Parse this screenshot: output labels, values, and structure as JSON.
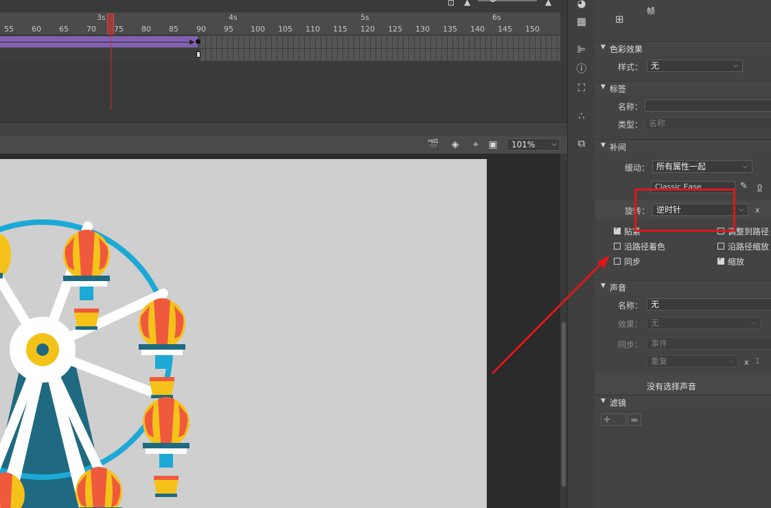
{
  "timeline": {
    "seconds": [
      "3s",
      "4s",
      "5s",
      "6s"
    ],
    "frame_ticks": [
      "55",
      "60",
      "65",
      "70",
      "75",
      "80",
      "85",
      "90",
      "95",
      "100",
      "105",
      "110",
      "115",
      "120",
      "125",
      "130",
      "135",
      "140",
      "145",
      "150"
    ],
    "current_frame": 73
  },
  "stage": {
    "zoom": "101%"
  },
  "dock_icons": [
    "palette-icon",
    "swatches-icon",
    "align-icon",
    "info-icon",
    "transform-icon",
    "motion-presets-icon",
    "library-icon"
  ],
  "properties": {
    "frame_label": "帧",
    "color_effect": {
      "title": "色彩效果",
      "style_label": "样式：",
      "style_value": "无"
    },
    "label": {
      "title": "标签",
      "name_label": "名称：",
      "name_value": "",
      "type_label": "类型：",
      "type_value": "名称"
    },
    "tween": {
      "title": "补间",
      "ease_label": "缓动：",
      "ease_value": "所有属性一起",
      "ease_preset": "Classic Ease",
      "ease_amount": "0",
      "rotate_label": "旋转：",
      "rotate_value": "逆时针",
      "rotate_times_sep": "x",
      "checkboxes": [
        {
          "label": "贴紧",
          "checked": true
        },
        {
          "label": "调整到路径",
          "checked": false
        },
        {
          "label": "沿路径着色",
          "checked": false
        },
        {
          "label": "沿路径缩放",
          "checked": false
        },
        {
          "label": "同步",
          "checked": false
        },
        {
          "label": "缩放",
          "checked": true
        }
      ]
    },
    "sound": {
      "title": "声音",
      "name_label": "名称：",
      "name_value": "无",
      "effect_label": "效果：",
      "effect_value": "无",
      "sync_label": "同步：",
      "sync_value": "事件",
      "repeat_value": "重复",
      "repeat_sep": "x",
      "repeat_count": "1",
      "no_sound": "没有选择声音"
    },
    "filters": {
      "title": "滤镜"
    }
  }
}
